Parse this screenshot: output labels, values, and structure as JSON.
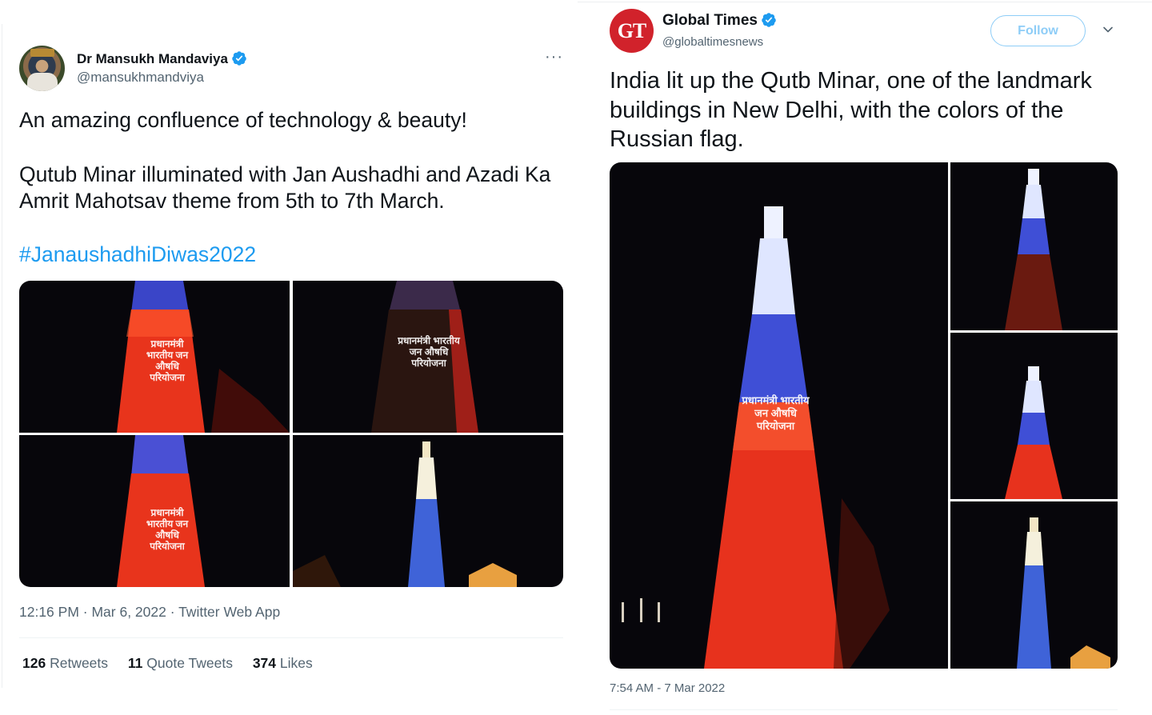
{
  "left_tweet": {
    "author_name": "Dr Mansukh Mandaviya",
    "author_handle": "@mansukhmandviya",
    "more_label": "···",
    "text_line1": "An amazing confluence of technology & beauty!",
    "text_paragraph2": "Qutub Minar illuminated with Jan Aushadhi and Azadi Ka Amrit Mahotsav theme from 5th to 7th March.",
    "hashtag": "#JanaushadhiDiwas2022",
    "projection_text": "प्रधानमंत्री भारतीय जन औषधि परियोजना",
    "timestamp": "12:16 PM · Mar 6, 2022 · Twitter Web App",
    "stats": {
      "retweets_count": "126",
      "retweets_label": "Retweets",
      "quote_count": "11",
      "quote_label": "Quote Tweets",
      "likes_count": "374",
      "likes_label": "Likes"
    }
  },
  "right_tweet": {
    "avatar_text": "GT",
    "author_name": "Global Times",
    "author_handle": "@globaltimesnews",
    "follow_label": "Follow",
    "text": "India lit up the Qutb Minar, one of the landmark buildings in New Delhi, with the colors of the Russian flag.",
    "timestamp": "7:54 AM - 7 Mar 2022"
  },
  "colors": {
    "verified_blue": "#1d9bf0",
    "link_blue": "#1d9bf0",
    "follow_border": "#8ecdf7",
    "gt_red": "#d1222b",
    "muted_text": "#536471"
  },
  "icons": {
    "verified": "verified-badge-icon",
    "more": "more-options-icon",
    "chevron": "chevron-down-icon"
  }
}
